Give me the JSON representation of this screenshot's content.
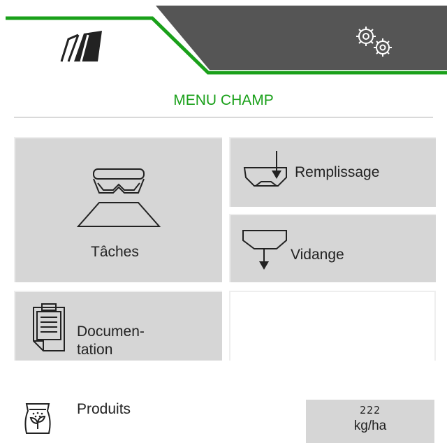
{
  "tabs": [
    {
      "name": "field",
      "icon": "field-tramline-icon",
      "active": true
    },
    {
      "name": "settings",
      "icon": "gears-icon",
      "active": false
    }
  ],
  "colors": {
    "accent": "#1aa01a",
    "tab_dark": "#555555",
    "tile": "#d6d6d6"
  },
  "menu": {
    "title": "MENU CHAMP"
  },
  "tiles": {
    "taches": {
      "label": "Tâches",
      "icon": "spreader-icon"
    },
    "remplissage": {
      "label": "Remplissage",
      "icon": "hopper-fill-icon"
    },
    "vidange": {
      "label": "Vidange",
      "icon": "hopper-empty-icon"
    },
    "documentation": {
      "label_line1": "Documen-",
      "label_line2": "tation",
      "icon": "clipboard-icon"
    }
  },
  "produits": {
    "label": "Produits",
    "icon": "fertilizer-bag-icon",
    "rate_value": "222",
    "rate_unit": "kg/ha"
  }
}
